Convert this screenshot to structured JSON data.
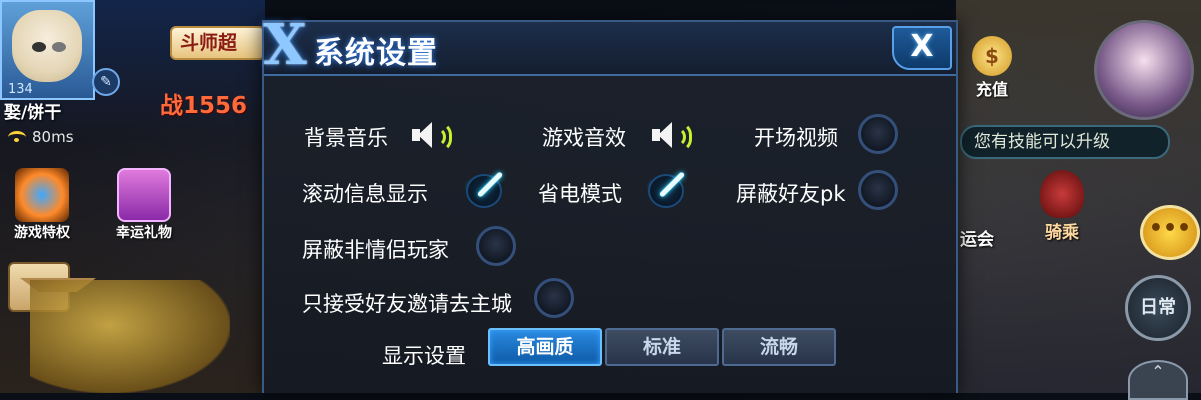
{
  "hud": {
    "player_level": "134",
    "player_name": "娶/饼干",
    "ping": "80ms",
    "rank_title": "斗师超",
    "power": "战1556",
    "privilege_label": "游戏特权",
    "gift_label": "幸运礼物",
    "recharge_coin": "$",
    "recharge_label": "充值",
    "skill_tip": "您有技能可以升级",
    "games_label": "运会",
    "ride_label": "骑乘",
    "chat_glyph": "•••",
    "daily_label": "日常"
  },
  "dialog": {
    "title": "系统设置",
    "close_glyph": "X",
    "emblem_glyph": "X",
    "options": {
      "bgm": {
        "label": "背景音乐",
        "state": "sound-on"
      },
      "sfx": {
        "label": "游戏音效",
        "state": "sound-on"
      },
      "intro_video": {
        "label": "开场视频",
        "checked": false
      },
      "scroll_info": {
        "label": "滚动信息显示",
        "checked": true
      },
      "power_save": {
        "label": "省电模式",
        "checked": true
      },
      "block_friend_pk": {
        "label": "屏蔽好友pk",
        "checked": false
      },
      "block_non_couple": {
        "label": "屏蔽非情侣玩家",
        "checked": false
      },
      "friend_invite_only": {
        "label": "只接受好友邀请去主城",
        "checked": false
      }
    },
    "display": {
      "label": "显示设置",
      "options": [
        "高画质",
        "标准",
        "流畅"
      ],
      "selected": "高画质"
    }
  }
}
